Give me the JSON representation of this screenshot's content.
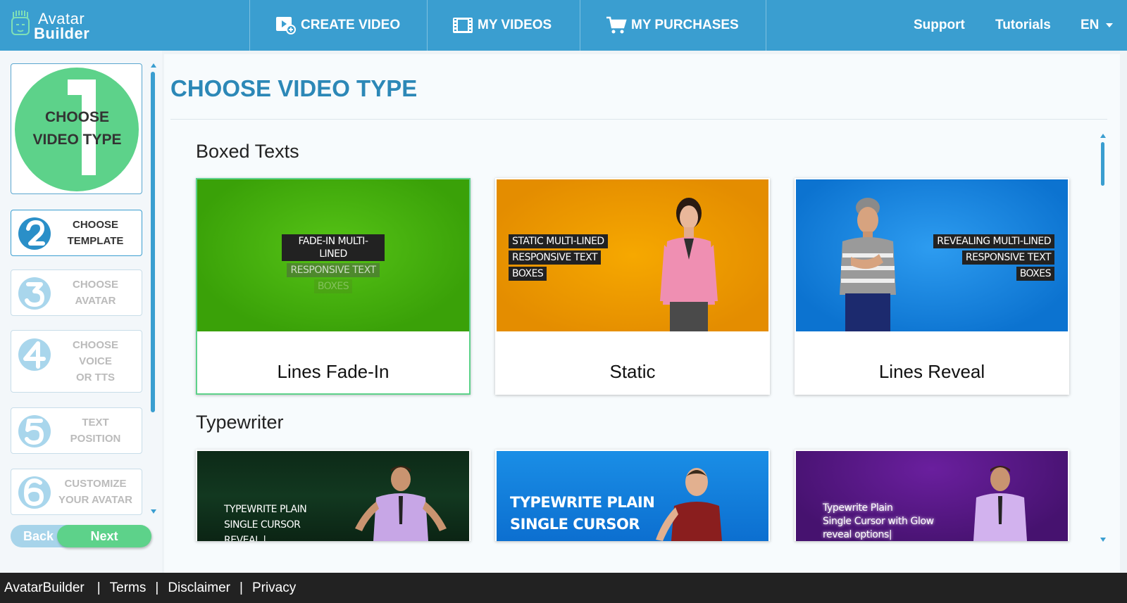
{
  "app": {
    "logo_line1": "Avatar",
    "logo_line2": "Builder"
  },
  "nav": {
    "create_video": "CREATE VIDEO",
    "my_videos": "MY VIDEOS",
    "my_purchases": "MY PURCHASES",
    "support": "Support",
    "tutorials": "Tutorials",
    "language": "EN"
  },
  "steps": [
    {
      "number": "1",
      "label_line1": "CHOOSE",
      "label_line2": "VIDEO TYPE",
      "state": "current"
    },
    {
      "number": "2",
      "label_line1": "CHOOSE",
      "label_line2": "TEMPLATE",
      "state": "active"
    },
    {
      "number": "3",
      "label_line1": "CHOOSE",
      "label_line2": "AVATAR",
      "state": "disabled"
    },
    {
      "number": "4",
      "label_line1": "CHOOSE",
      "label_line2": "VOICE",
      "label_line3": "OR TTS",
      "state": "disabled"
    },
    {
      "number": "5",
      "label_line1": "TEXT",
      "label_line2": "POSITION",
      "state": "disabled"
    },
    {
      "number": "6",
      "label_line1": "CUSTOMIZE",
      "label_line2": "YOUR AVATAR",
      "state": "disabled"
    }
  ],
  "buttons": {
    "back": "Back",
    "next": "Next"
  },
  "page": {
    "title": "CHOOSE VIDEO TYPE"
  },
  "sections": [
    {
      "title": "Boxed Texts",
      "cards": [
        {
          "name": "Lines Fade-In",
          "selected": true,
          "caption": [
            "FADE-IN MULTI-LINED",
            "RESPONSIVE TEXT",
            "BOXES"
          ]
        },
        {
          "name": "Static",
          "selected": false,
          "caption": [
            "STATIC MULTI-LINED",
            "RESPONSIVE TEXT",
            "BOXES"
          ]
        },
        {
          "name": "Lines Reveal",
          "selected": false,
          "caption": [
            "REVEALING MULTI-LINED",
            "RESPONSIVE TEXT",
            "BOXES"
          ]
        }
      ]
    },
    {
      "title": "Typewriter",
      "cards": [
        {
          "caption": [
            "TYPEWRITE PLAIN",
            "SINGLE CURSOR",
            "REVEAL |"
          ]
        },
        {
          "caption": [
            "TYPEWRITE PLAIN",
            "SINGLE CURSOR"
          ]
        },
        {
          "caption": [
            "Typewrite Plain",
            "Single Cursor with Glow",
            "reveal options|"
          ]
        }
      ]
    }
  ],
  "footer": {
    "brand": "AvatarBuilder",
    "terms": "Terms",
    "disclaimer": "Disclaimer",
    "privacy": "Privacy"
  },
  "colors": {
    "nav_bg": "#3a9ed0",
    "accent_green": "#5dd28a",
    "title_blue": "#2c88b7",
    "footer_bg": "#222222"
  }
}
